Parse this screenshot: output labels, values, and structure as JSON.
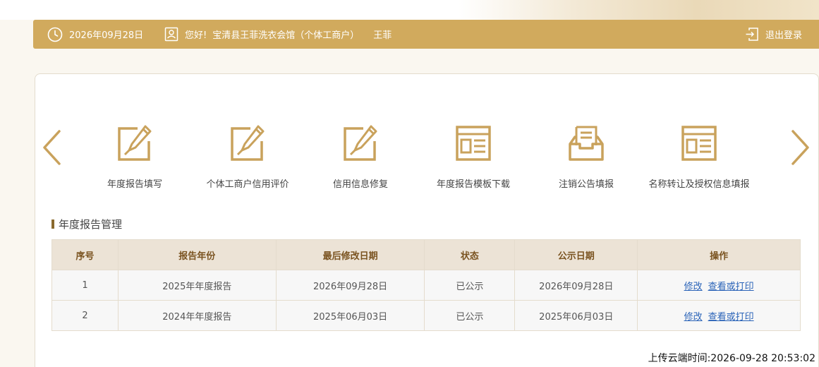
{
  "header": {
    "date": "2026年09月28日",
    "greeting": "您好!",
    "company": "宝清县王菲洗衣会馆（个体工商户）",
    "username": "王菲",
    "logout_label": "退出登录",
    "icons": [
      "clock-icon",
      "user-card-icon",
      "logout-icon"
    ]
  },
  "services": [
    {
      "label": "年度报告填写",
      "icon": "edit-icon"
    },
    {
      "label": "个体工商户信用评价",
      "icon": "edit-icon"
    },
    {
      "label": "信用信息修复",
      "icon": "edit-icon"
    },
    {
      "label": "年度报告模板下载",
      "icon": "template-icon"
    },
    {
      "label": "注销公告填报",
      "icon": "inbox-icon"
    },
    {
      "label": "名称转让及授权信息填报",
      "icon": "template-icon"
    }
  ],
  "section": {
    "title": "年度报告管理"
  },
  "table": {
    "headers": [
      "序号",
      "报告年份",
      "最后修改日期",
      "状态",
      "公示日期",
      "操作"
    ],
    "rows": [
      {
        "no": "1",
        "year": "2025年年度报告",
        "modified": "2026年09月28日",
        "status": "已公示",
        "published": "2026年09月28日",
        "edit": "修改",
        "view": "查看或打印"
      },
      {
        "no": "2",
        "year": "2024年年度报告",
        "modified": "2025年06月03日",
        "status": "已公示",
        "published": "2025年06月03日",
        "edit": "修改",
        "view": "查看或打印"
      }
    ]
  },
  "footer": {
    "upload_time": "上传云端时间:2026-09-28 20:53:02"
  },
  "colors": {
    "accent": "#d1aa5d",
    "icon": "#c9a25c",
    "header_text": "#ffffff",
    "link": "#2a63b8",
    "table_header_bg": "#ece3d6"
  }
}
